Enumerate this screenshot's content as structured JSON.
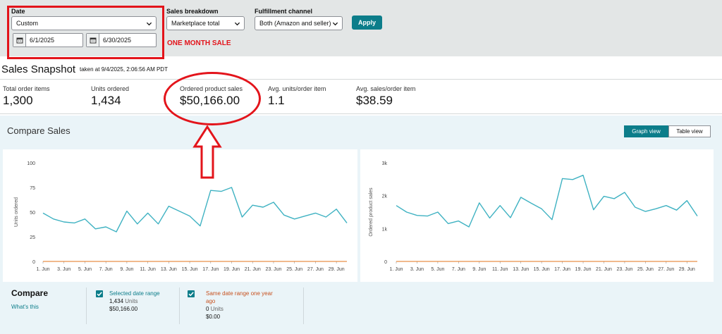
{
  "filters": {
    "date_label": "Date",
    "date_preset": "Custom",
    "start_date": "6/1/2025",
    "end_date": "6/30/2025",
    "breakdown_label": "Sales breakdown",
    "breakdown_value": "Marketplace total",
    "channel_label": "Fulfillment channel",
    "channel_value": "Both (Amazon and seller)",
    "apply_label": "Apply"
  },
  "annotation": {
    "text": "ONE MONTH SALE",
    "color": "#e3141b"
  },
  "snapshot": {
    "title": "Sales Snapshot",
    "taken_at": "taken at 9/4/2025, 2:06:56 AM PDT",
    "metrics": [
      {
        "label": "Total order items",
        "value": "1,300"
      },
      {
        "label": "Units ordered",
        "value": "1,434"
      },
      {
        "label": "Ordered product sales",
        "value": "$50,166.00"
      },
      {
        "label": "Avg. units/order item",
        "value": "1.1"
      },
      {
        "label": "Avg. sales/order item",
        "value": "$38.59"
      }
    ]
  },
  "compare_sales": {
    "title": "Compare Sales",
    "graph_view_label": "Graph view",
    "table_view_label": "Table view"
  },
  "compare": {
    "title": "Compare",
    "whats_this": "What's this",
    "selected": {
      "label": "Selected date range",
      "units": "1,434",
      "units_word": "Units",
      "sales": "$50,166.00"
    },
    "last_year": {
      "label_line1": "Same date range one year",
      "label_line2": "ago",
      "units": "0",
      "units_word": "Units",
      "sales": "$0.00"
    }
  },
  "colors": {
    "accent": "#0c7d8a",
    "selected_series": "#0c7d8a",
    "last_year_series": "#c7511f",
    "chart_line": "#3fb2c2",
    "baseline": "#e3731b"
  },
  "chart_data": [
    {
      "type": "line",
      "ylabel": "Units ordered",
      "ylim": [
        0,
        100
      ],
      "y_ticks": [
        "0",
        "25",
        "50",
        "75",
        "100"
      ],
      "x_tick_labels": [
        "1. Jun",
        "3. Jun",
        "5. Jun",
        "7. Jun",
        "9. Jun",
        "11. Jun",
        "13. Jun",
        "15. Jun",
        "17. Jun",
        "19. Jun",
        "21. Jun",
        "23. Jun",
        "25. Jun",
        "27. Jun",
        "29. Jun"
      ],
      "grid": false,
      "series": [
        {
          "name": "Selected date range",
          "values": [
            49,
            43,
            40,
            39,
            43,
            33,
            35,
            30,
            51,
            38,
            49,
            38,
            56,
            51,
            46,
            36,
            72,
            71,
            75,
            45,
            57,
            55,
            60,
            47,
            43,
            46,
            49,
            45,
            53,
            39
          ]
        },
        {
          "name": "Same date range one year ago",
          "values": [
            0,
            0,
            0,
            0,
            0,
            0,
            0,
            0,
            0,
            0,
            0,
            0,
            0,
            0,
            0,
            0,
            0,
            0,
            0,
            0,
            0,
            0,
            0,
            0,
            0,
            0,
            0,
            0,
            0,
            0
          ]
        }
      ]
    },
    {
      "type": "line",
      "ylabel": "Ordered product sales",
      "ylim": [
        0,
        3000
      ],
      "y_ticks": [
        "0",
        "1k",
        "2k",
        "3k"
      ],
      "x_tick_labels": [
        "1. Jun",
        "3. Jun",
        "5. Jun",
        "7. Jun",
        "9. Jun",
        "11. Jun",
        "13. Jun",
        "15. Jun",
        "17. Jun",
        "19. Jun",
        "21. Jun",
        "23. Jun",
        "25. Jun",
        "27. Jun",
        "29. Jun"
      ],
      "grid": false,
      "series": [
        {
          "name": "Selected date range",
          "values": [
            1700,
            1500,
            1400,
            1380,
            1500,
            1150,
            1230,
            1050,
            1780,
            1320,
            1700,
            1330,
            1950,
            1770,
            1600,
            1270,
            2520,
            2490,
            2620,
            1570,
            1980,
            1910,
            2100,
            1650,
            1520,
            1600,
            1700,
            1560,
            1850,
            1380
          ]
        },
        {
          "name": "Same date range one year ago",
          "values": [
            0,
            0,
            0,
            0,
            0,
            0,
            0,
            0,
            0,
            0,
            0,
            0,
            0,
            0,
            0,
            0,
            0,
            0,
            0,
            0,
            0,
            0,
            0,
            0,
            0,
            0,
            0,
            0,
            0,
            0
          ]
        }
      ]
    }
  ]
}
